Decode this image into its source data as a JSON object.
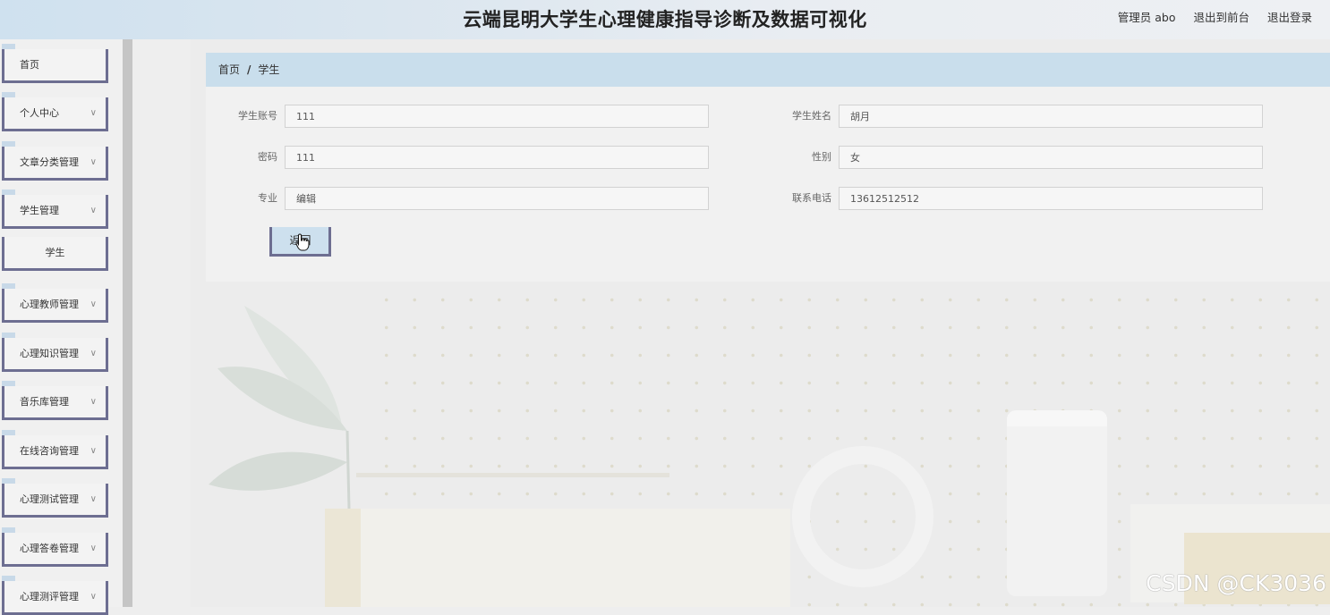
{
  "header": {
    "title": "云端昆明大学生心理健康指导诊断及数据可视化",
    "admin_label": "管理员 abo",
    "to_front": "退出到前台",
    "logout": "退出登录"
  },
  "sidebar": {
    "items": [
      {
        "label": "首页",
        "has_chevron": false
      },
      {
        "label": "个人中心",
        "has_chevron": true
      },
      {
        "label": "文章分类管理",
        "has_chevron": true
      },
      {
        "label": "学生管理",
        "has_chevron": true
      },
      {
        "label": "学生",
        "has_chevron": false,
        "sub": true
      },
      {
        "label": "心理教师管理",
        "has_chevron": true
      },
      {
        "label": "心理知识管理",
        "has_chevron": true
      },
      {
        "label": "音乐库管理",
        "has_chevron": true
      },
      {
        "label": "在线咨询管理",
        "has_chevron": true
      },
      {
        "label": "心理测试管理",
        "has_chevron": true
      },
      {
        "label": "心理答卷管理",
        "has_chevron": true
      },
      {
        "label": "心理测评管理",
        "has_chevron": true
      }
    ],
    "chevron": "∨"
  },
  "breadcrumb": {
    "home": "首页",
    "separator": "/",
    "current": "学生"
  },
  "form": {
    "student_account": {
      "label": "学生账号",
      "value": "111"
    },
    "student_name": {
      "label": "学生姓名",
      "value": "胡月"
    },
    "password": {
      "label": "密码",
      "value": "111"
    },
    "gender": {
      "label": "性别",
      "value": "女"
    },
    "major": {
      "label": "专业",
      "value": "编辑"
    },
    "phone": {
      "label": "联系电话",
      "value": "13612512512"
    },
    "back_button": "返回"
  },
  "watermark": "CSDN @CK3036",
  "colors": {
    "accent_border": "#6d6e91",
    "breadcrumb_bg": "#c9deec",
    "header_bg": "#cfe1ef"
  },
  "icons": [
    "chevron-down-icon",
    "hand-pointer-cursor-icon"
  ]
}
